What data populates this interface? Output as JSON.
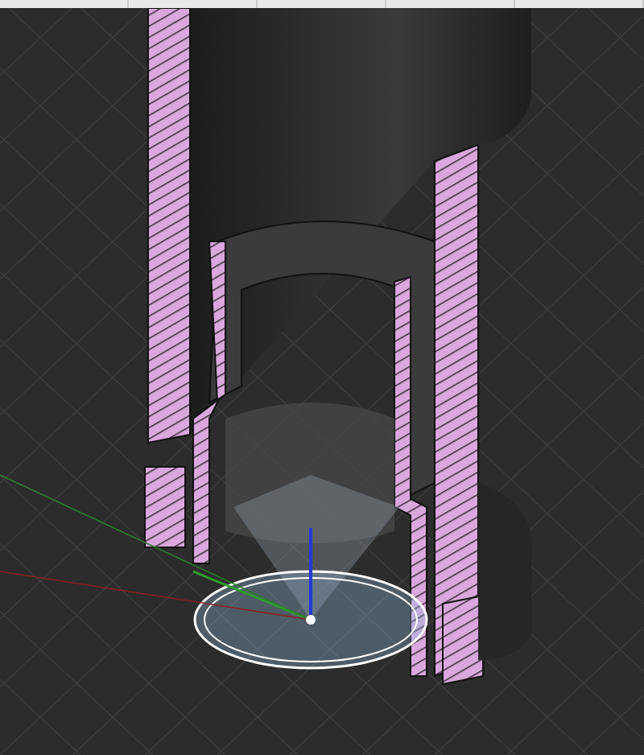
{
  "toolbar": {
    "sections": [
      {
        "kind": "group"
      },
      {
        "kind": "group"
      },
      {
        "kind": "group"
      },
      {
        "kind": "group"
      },
      {
        "kind": "group"
      }
    ]
  },
  "viewport": {
    "grid": true,
    "triad": true,
    "sketch_circle": true
  }
}
